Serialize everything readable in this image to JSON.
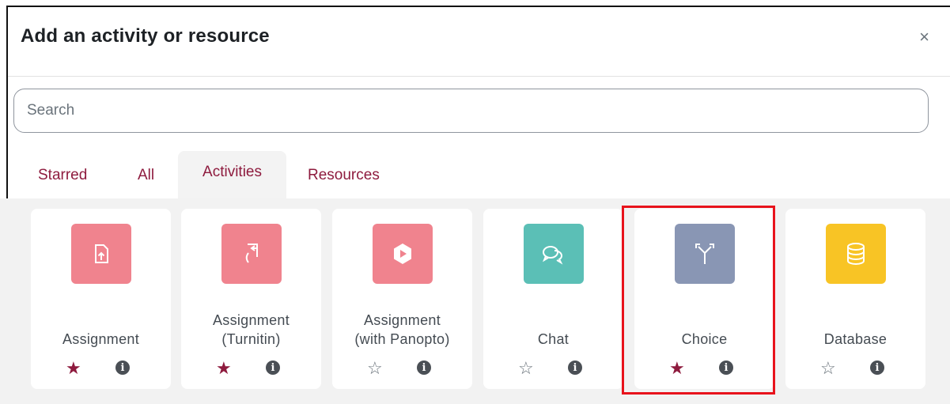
{
  "dialog": {
    "title": "Add an activity or resource",
    "close_symbol": "×"
  },
  "search": {
    "placeholder": "Search",
    "value": ""
  },
  "tabs": [
    {
      "label": "Starred",
      "active": false
    },
    {
      "label": "All",
      "active": false
    },
    {
      "label": "Activities",
      "active": true
    },
    {
      "label": "Resources",
      "active": false
    }
  ],
  "cards": [
    {
      "name": "Assignment",
      "icon": "assignment-upload-icon",
      "color": "#f0838e",
      "starred": true
    },
    {
      "name": "Assignment\n(Turnitin)",
      "icon": "turnitin-icon",
      "color": "#f0838e",
      "starred": true
    },
    {
      "name": "Assignment\n(with Panopto)",
      "icon": "panopto-play-icon",
      "color": "#f0838e",
      "starred": false
    },
    {
      "name": "Chat",
      "icon": "chat-bubbles-icon",
      "color": "#5bbfb6",
      "starred": false
    },
    {
      "name": "Choice",
      "icon": "choice-signpost-icon",
      "color": "#8996b4",
      "starred": true
    },
    {
      "name": "Database",
      "icon": "database-icon",
      "color": "#f8c425",
      "starred": false
    }
  ],
  "symbols": {
    "star_filled": "★",
    "star_empty": "☆",
    "info": "i"
  },
  "colors": {
    "accent": "#8e1b3e",
    "highlight_box": "#e8131c"
  }
}
